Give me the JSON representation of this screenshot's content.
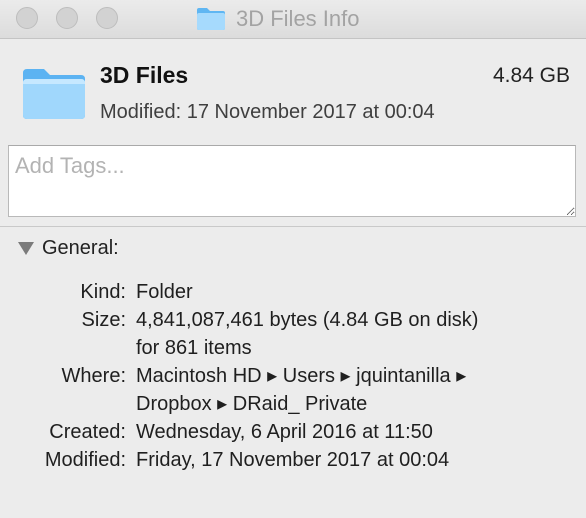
{
  "window": {
    "title": "3D Files Info",
    "traffic_lights": [
      "close",
      "minimize",
      "zoom"
    ]
  },
  "header": {
    "name": "3D Files",
    "size": "4.84 GB",
    "modified": "Modified: 17 November 2017 at 00:04",
    "icon": "folder-icon"
  },
  "tags": {
    "placeholder": "Add Tags..."
  },
  "general": {
    "label": "General:",
    "rows": [
      {
        "label": "Kind:",
        "value": "Folder"
      },
      {
        "label": "Size:",
        "value": "4,841,087,461 bytes (4.84 GB on disk)"
      },
      {
        "label": "",
        "value": "for 861 items"
      },
      {
        "label": "Where:",
        "value": "Macintosh HD ▸ Users ▸ jquintanilla ▸"
      },
      {
        "label": "",
        "value": "Dropbox ▸ DRaid_ Private"
      },
      {
        "label": "Created:",
        "value": "Wednesday, 6 April 2016 at 11:50"
      },
      {
        "label": "Modified:",
        "value": "Friday, 17 November 2017 at 00:04"
      }
    ]
  },
  "colors": {
    "folder_light": "#9fd6fb",
    "folder_dark": "#5cb3f2"
  }
}
